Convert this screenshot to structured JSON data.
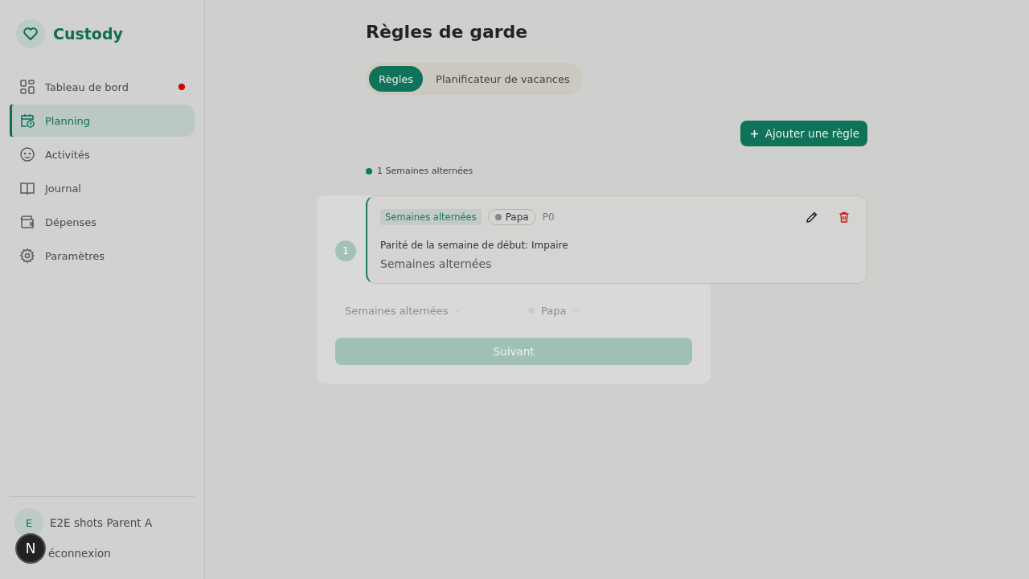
{
  "sidebar": {
    "brand": "Custody",
    "items": [
      {
        "label": "Tableau de bord",
        "selected": false,
        "badge": true
      },
      {
        "label": "Planning",
        "selected": true,
        "badge": false
      },
      {
        "label": "Activités",
        "selected": false,
        "badge": false
      },
      {
        "label": "Journal",
        "selected": false,
        "badge": false
      },
      {
        "label": "Dépenses",
        "selected": false,
        "badge": false
      },
      {
        "label": "Paramètres",
        "selected": false,
        "badge": false
      }
    ],
    "user": {
      "initial": "E",
      "name": "E2E shots Parent A"
    },
    "logout": "éconnexion"
  },
  "dev_badge": "N",
  "page": {
    "title": "Règles de garde",
    "tabs": [
      {
        "label": "Règles",
        "selected": true
      },
      {
        "label": "Planificateur de vacances",
        "selected": false
      }
    ],
    "add_button": "Ajouter une règle",
    "legend": [
      {
        "label": "1 Semaines alternées",
        "color": "#0e7a5a"
      }
    ],
    "rules": [
      {
        "type": "Semaines alternées",
        "parent": "Papa",
        "code": "P0",
        "detail": "Parité de la semaine de début: Impaire",
        "name": "Semaines alternées"
      }
    ]
  },
  "modal": {
    "steps": [
      {
        "number": "1",
        "selected": true
      }
    ],
    "fields": [
      {
        "kind": "select",
        "value": "Semaines alternées"
      },
      {
        "kind": "person",
        "value": "Papa",
        "color": "#cdcdcb"
      }
    ],
    "next_button": "Suivant"
  }
}
